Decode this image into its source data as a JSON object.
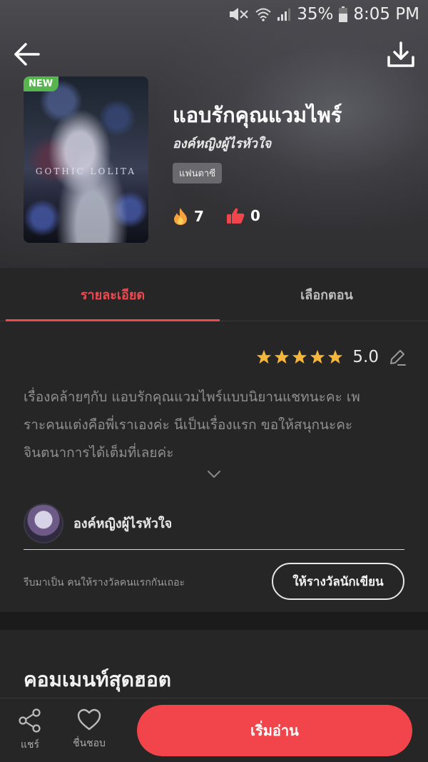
{
  "status_bar": {
    "battery": "35%",
    "time": "8:05 PM"
  },
  "header": {
    "back_icon": "arrow-left-icon",
    "download_icon": "download-icon"
  },
  "novel": {
    "badge": "NEW",
    "cover_text": "GOTHIC LOLITA",
    "title": "แอบรักคุณแวมไพร์",
    "author": "องค์หญิงผู้ไรหัวใจ",
    "genre": "แฟนตาซี",
    "fire_count": "7",
    "like_count": "0"
  },
  "tabs": [
    {
      "label": "รายละเอียด",
      "active": true
    },
    {
      "label": "เลือกตอน",
      "active": false
    }
  ],
  "detail": {
    "rating_value": "5.0",
    "rating_stars": 5,
    "description_lines": [
      "เรื่องคล้ายๆกับ แอบรักคุณแวมไพร์แบบนิยานแชทนะคะ เพ",
      "ราะคนแต่งคือพี่เราเองค่ะ นีเป็นเรื่องแรก ขอให้สนุกนะคะ",
      "จินตนาการได้เต็มที่เลยค่ะ"
    ],
    "author_name": "องค์หญิงผู้ไรหัวใจ",
    "reward_prompt": "รีบมาเป็น คนให้รางวัลคนแรกกันเถอะ",
    "reward_button": "ให้รางวัลนักเขียน"
  },
  "comments": {
    "title": "คอมเมนท์สุดฮอต"
  },
  "bottom_bar": {
    "share_label": "แชร์",
    "like_label": "ชื่นชอบ",
    "start_label": "เริ่มอ่าน"
  },
  "colors": {
    "accent": "#f2444b",
    "new_badge": "#56b54c",
    "star": "#f5b73b",
    "background": "#262626"
  }
}
